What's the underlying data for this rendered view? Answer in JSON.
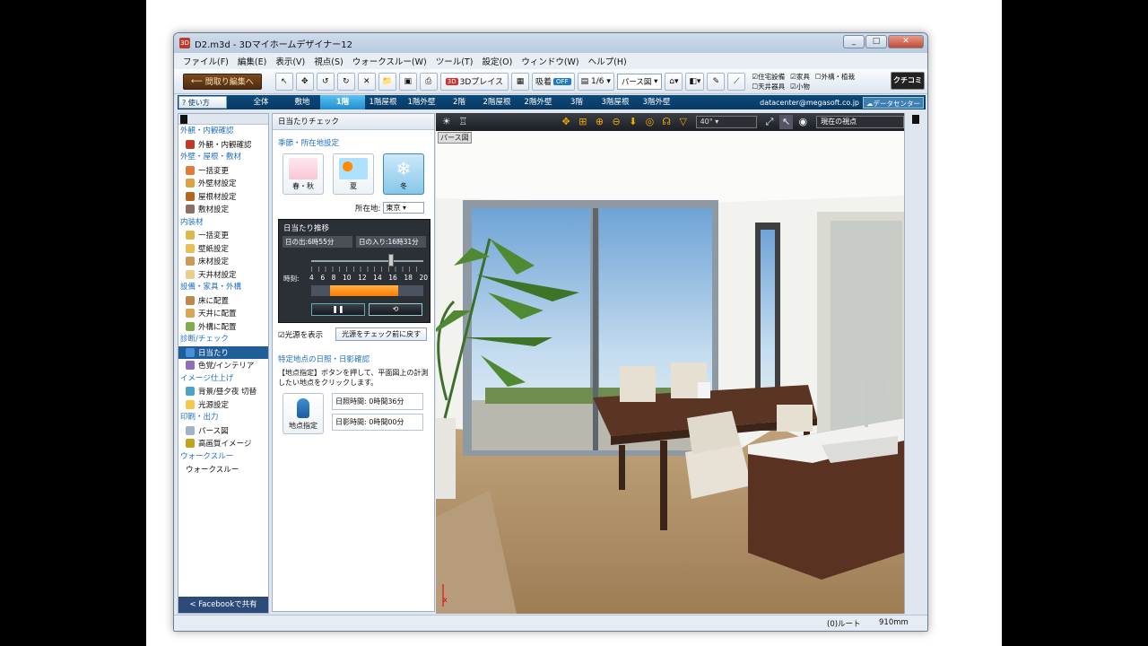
{
  "window": {
    "title": "D2.m3d - 3Dマイホームデザイナー12"
  },
  "menu": [
    "ファイル(F)",
    "編集(E)",
    "表示(V)",
    "視点(S)",
    "ウォークスルー(W)",
    "ツール(T)",
    "設定(O)",
    "ウィンドウ(W)",
    "ヘルプ(H)"
  ],
  "toolbar": {
    "back_label": "間取り編集へ",
    "place_3d": "3Dプレイス",
    "snap_label": "吸着",
    "snap_state": "OFF",
    "scale": "1/6",
    "view_mode": "パース図",
    "checks": [
      "住宅設備",
      "家具",
      "外構・植栽",
      "天井器具",
      "小物"
    ],
    "kuchikomi": "クチコミ"
  },
  "tabbar": {
    "howto": "使い方",
    "tabs": [
      "全体",
      "敷地",
      "1階",
      "1階屋根",
      "1階外壁",
      "2階",
      "2階屋根",
      "2階外壁",
      "3階",
      "3階屋根",
      "3階外壁"
    ],
    "active": "1階",
    "site": "datacenter@megasoft.co.jp",
    "datacenter": "データセンター"
  },
  "sidebar": {
    "sections": [
      {
        "title": "外観・内観確認",
        "items": [
          "外観・内観確認"
        ]
      },
      {
        "title": "外壁・屋根・敷材",
        "items": [
          "一括変更",
          "外壁材設定",
          "屋根材設定",
          "敷材設定"
        ]
      },
      {
        "title": "内装材",
        "items": [
          "一括変更",
          "壁紙設定",
          "床材設定",
          "天井材設定"
        ]
      },
      {
        "title": "設備・家具・外構",
        "items": [
          "床に配置",
          "天井に配置",
          "外構に配置"
        ]
      },
      {
        "title": "診断/チェック",
        "items": [
          "日当たり",
          "色覚/インテリア"
        ]
      },
      {
        "title": "イメージ仕上げ",
        "items": [
          "背景/昼夕夜 切替",
          "光源設定"
        ]
      },
      {
        "title": "印刷・出力",
        "items": [
          "パース図",
          "高画質イメージ"
        ]
      },
      {
        "title": "ウォークスルー",
        "items": [
          "ウォークスルー"
        ]
      }
    ],
    "active_item": "日当たり",
    "facebook": "Facebookで共有"
  },
  "panel": {
    "header": "日当たりチェック",
    "season_title": "季節・所在地設定",
    "seasons": [
      "春・秋",
      "夏",
      "冬"
    ],
    "active_season": "冬",
    "location_label": "所在地:",
    "location_value": "東京",
    "sun_title": "日当たり推移",
    "sunrise": "日の出:6時55分",
    "sunset": "日の入り:16時31分",
    "hour_label": "時刻:",
    "hours": [
      "4",
      "6",
      "8",
      "10",
      "12",
      "14",
      "16",
      "18",
      "20"
    ],
    "show_light": "光源を表示",
    "reset_light": "光源をチェック前に戻す",
    "spot_title": "特定地点の日照・日影確認",
    "spot_desc": "【地点指定】ボタンを押して、平面図上の計測したい地点をクリックします。",
    "spot_button": "地点指定",
    "sun_hours": "日照時間: 0時間36分",
    "shade_hours": "日影時間: 0時間00分"
  },
  "view": {
    "fov": "40°",
    "viewpoint": "現在の視点",
    "label": "パース図"
  },
  "status": {
    "route": "(0)ルート",
    "grid": "910mm"
  }
}
